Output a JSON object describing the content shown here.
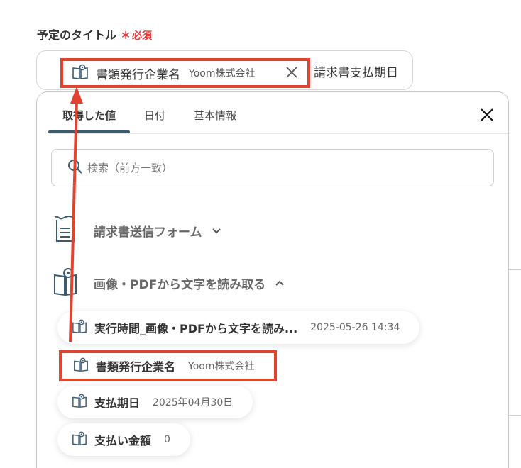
{
  "field": {
    "label": "予定のタイトル",
    "required_mark": "＊",
    "required_text": "必須"
  },
  "title_input": {
    "token": {
      "title": "書類発行企業名",
      "value": "Yoom株式会社"
    },
    "after_text": "請求書支払期日"
  },
  "panel": {
    "tabs": [
      {
        "label": "取得した値",
        "active": true
      },
      {
        "label": "日付",
        "active": false
      },
      {
        "label": "基本情報",
        "active": false
      }
    ],
    "search": {
      "placeholder": "検索（前方一致）"
    },
    "sections": [
      {
        "title": "請求書送信フォーム",
        "expanded": false,
        "icon": "form-icon"
      },
      {
        "title": "画像・PDFから文字を読み取る",
        "expanded": true,
        "icon": "book-icon"
      }
    ],
    "items": [
      {
        "name": "実行時間_画像・PDFから文字を読み...",
        "value": "2025-05-26 14:34",
        "highlighted": false
      },
      {
        "name": "書類発行企業名",
        "value": "Yoom株式会社",
        "highlighted": true
      },
      {
        "name": "支払期日",
        "value": "2025年04月30日",
        "highlighted": false
      },
      {
        "name": "支払い金額",
        "value": "0",
        "highlighted": false
      }
    ]
  },
  "colors": {
    "highlight": "#e0442f",
    "tab_indicator": "#3d5b6e",
    "required": "#e0403a"
  }
}
